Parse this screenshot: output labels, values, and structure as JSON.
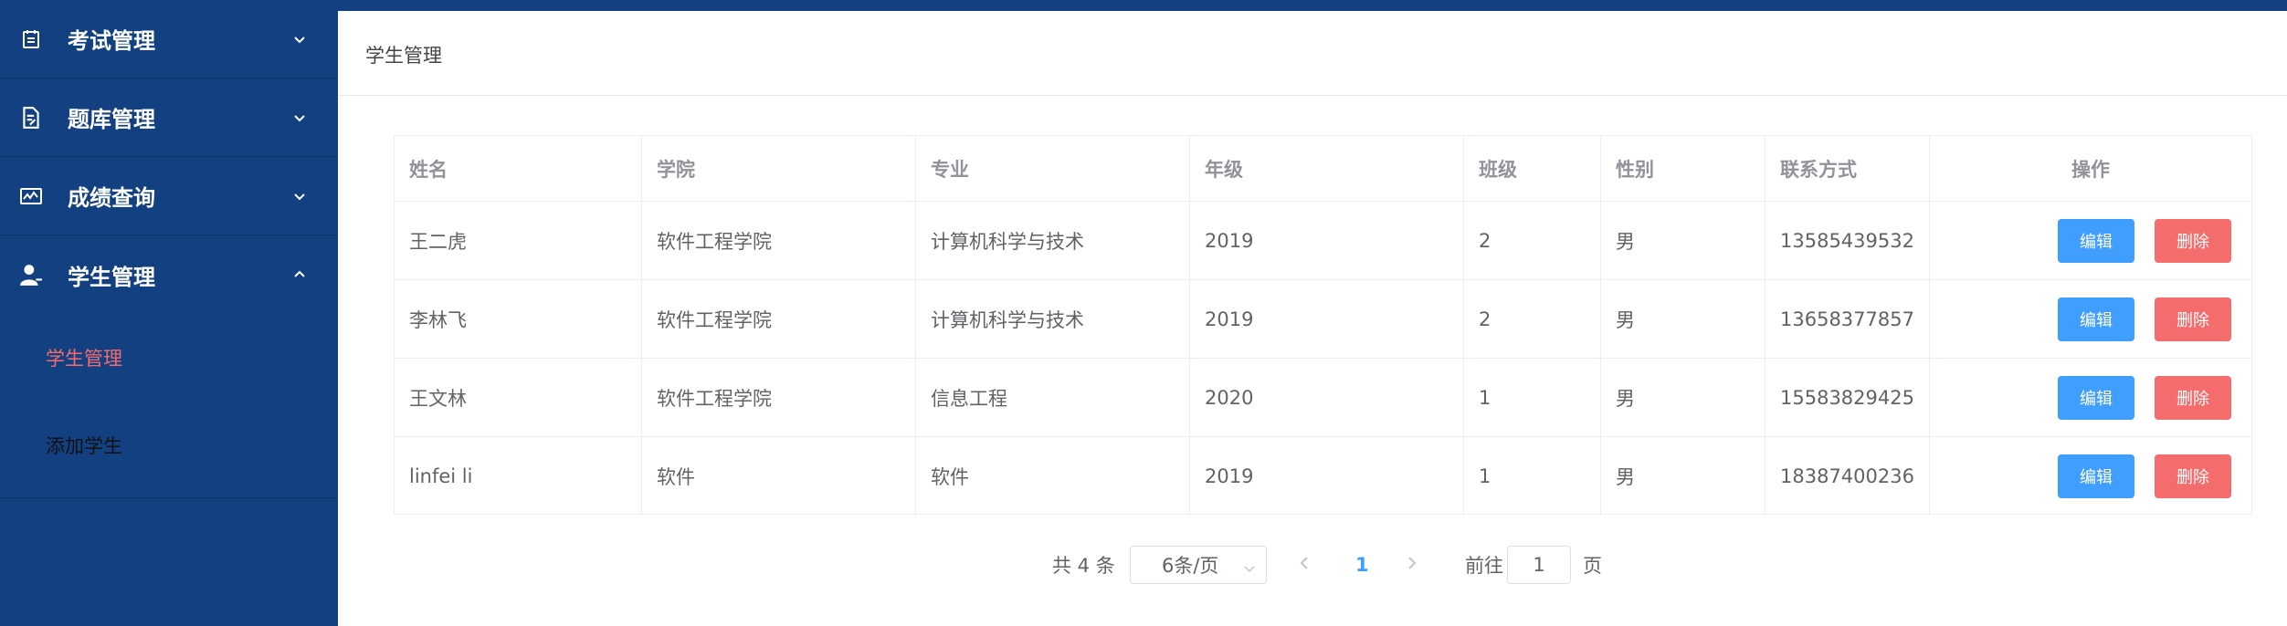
{
  "sidebar": {
    "menus": [
      {
        "label": "考试管理",
        "icon": "calendar-icon",
        "expanded": false
      },
      {
        "label": "题库管理",
        "icon": "document-edit-icon",
        "expanded": false
      },
      {
        "label": "成绩查询",
        "icon": "chart-card-icon",
        "expanded": false
      },
      {
        "label": "学生管理",
        "icon": "user-icon",
        "expanded": true
      }
    ],
    "submenu": [
      {
        "label": "学生管理",
        "active": true
      },
      {
        "label": "添加学生",
        "active": false
      }
    ]
  },
  "breadcrumb": "学生管理",
  "table": {
    "headers": [
      "姓名",
      "学院",
      "专业",
      "年级",
      "班级",
      "性别",
      "联系方式",
      "操作"
    ],
    "rows": [
      {
        "name": "王二虎",
        "college": "软件工程学院",
        "major": "计算机科学与技术",
        "grade": "2019",
        "class": "2",
        "gender": "男",
        "phone": "13585439532"
      },
      {
        "name": "李林飞",
        "college": "软件工程学院",
        "major": "计算机科学与技术",
        "grade": "2019",
        "class": "2",
        "gender": "男",
        "phone": "13658377857"
      },
      {
        "name": "王文林",
        "college": "软件工程学院",
        "major": "信息工程",
        "grade": "2020",
        "class": "1",
        "gender": "男",
        "phone": "15583829425"
      },
      {
        "name": "linfei li",
        "college": "软件",
        "major": "软件",
        "grade": "2019",
        "class": "1",
        "gender": "男",
        "phone": "18387400236"
      }
    ],
    "edit_label": "编辑",
    "delete_label": "删除"
  },
  "pagination": {
    "total_text": "共 4 条",
    "page_size": "6条/页",
    "current_page": "1",
    "goto_label": "前往",
    "goto_value": "1",
    "page_unit": "页"
  },
  "colors": {
    "sidebar_bg": "#124080",
    "accent_blue": "#409eff",
    "danger_red": "#f56c6c"
  }
}
